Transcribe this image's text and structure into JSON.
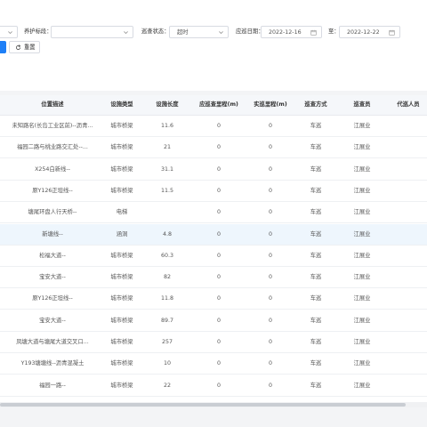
{
  "filters": {
    "first_select": {
      "value": ""
    },
    "maintain_label": "养护标段：",
    "maintain_select": {
      "value": ""
    },
    "status_label": "巡查状态：",
    "status_select": {
      "value": "超时"
    },
    "date_label": "应巡日期：",
    "date_start": "2022-12-16",
    "date_to": "至：",
    "date_end": "2022-12-22"
  },
  "buttons": {
    "reset_label": "重置"
  },
  "table": {
    "headers": [
      "位置描述",
      "设施类型",
      "设施长度",
      "应巡查里程(m)",
      "实巡里程(m)",
      "巡查方式",
      "巡查员",
      "代巡人员"
    ],
    "rows": [
      [
        "未知路名(长岛工业区前)--沥青...",
        "城市桥梁",
        "11.6",
        "0",
        "0",
        "车巡",
        "江展业",
        ""
      ],
      [
        "福园二路与桃业路交汇处--...",
        "城市桥梁",
        "21",
        "0",
        "0",
        "车巡",
        "江展业",
        ""
      ],
      [
        "X254白新线--",
        "城市桥梁",
        "31.1",
        "0",
        "0",
        "车巡",
        "江展业",
        ""
      ],
      [
        "原Y126正坦线--",
        "城市桥梁",
        "11.5",
        "0",
        "0",
        "车巡",
        "江展业",
        ""
      ],
      [
        "塘尾环盘人行天桥--",
        "电梯",
        "",
        "0",
        "0",
        "车巡",
        "江展业",
        ""
      ],
      [
        "新塘线--",
        "涵洞",
        "4.8",
        "0",
        "0",
        "车巡",
        "江展业",
        ""
      ],
      [
        "松福大道--",
        "城市桥梁",
        "60.3",
        "0",
        "0",
        "车巡",
        "江展业",
        ""
      ],
      [
        "宝安大道--",
        "城市桥梁",
        "82",
        "0",
        "0",
        "车巡",
        "江展业",
        ""
      ],
      [
        "原Y126正坦线--",
        "城市桥梁",
        "11.8",
        "0",
        "0",
        "车巡",
        "江展业",
        ""
      ],
      [
        "宝安大道--",
        "城市桥梁",
        "89.7",
        "0",
        "0",
        "车巡",
        "江展业",
        ""
      ],
      [
        "凤塘大道与塘尾大道交叉口...",
        "城市桥梁",
        "257",
        "0",
        "0",
        "车巡",
        "江展业",
        ""
      ],
      [
        "Y193塘塘线--沥青混凝土",
        "城市桥梁",
        "10",
        "0",
        "0",
        "车巡",
        "江展业",
        ""
      ],
      [
        "福园一路--",
        "城市桥梁",
        "22",
        "0",
        "0",
        "车巡",
        "江展业",
        ""
      ]
    ],
    "highlighted_row": 5
  },
  "colors": {
    "primary": "#1e7ff7",
    "header_bg": "#f5f7fa",
    "highlight_row": "#eef6fd"
  }
}
